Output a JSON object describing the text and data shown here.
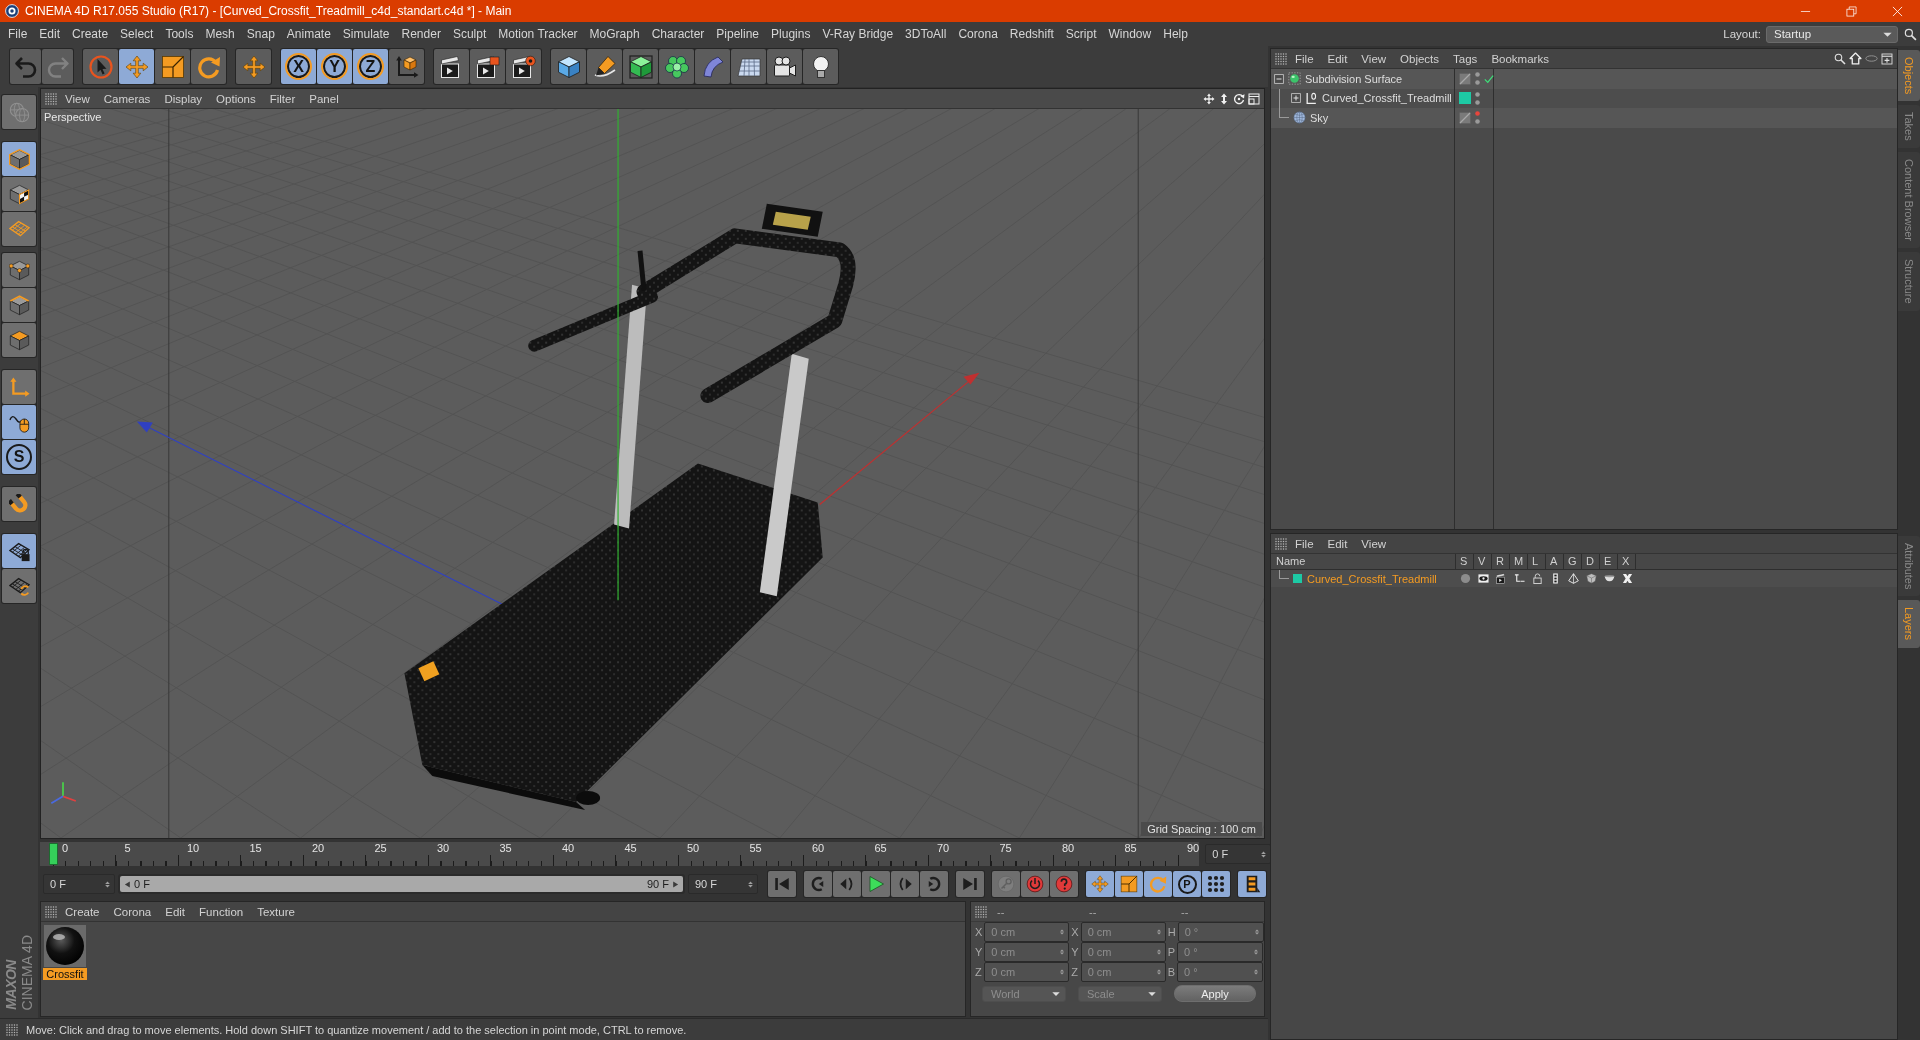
{
  "window": {
    "title": "CINEMA 4D R17.055 Studio (R17) - [Curved_Crossfit_Treadmill_c4d_standart.c4d *] - Main"
  },
  "menu_bar": [
    "File",
    "Edit",
    "Create",
    "Select",
    "Tools",
    "Mesh",
    "Snap",
    "Animate",
    "Simulate",
    "Render",
    "Sculpt",
    "Motion Tracker",
    "MoGraph",
    "Character",
    "Pipeline",
    "Plugins",
    "V-Ray Bridge",
    "3DToAll",
    "Corona",
    "Redshift",
    "Script",
    "Window",
    "Help"
  ],
  "layout": {
    "label": "Layout:",
    "value": "Startup"
  },
  "toolbar": [
    {
      "items": [
        {
          "kind": "undo",
          "selected": false,
          "disabled": false
        },
        {
          "kind": "redo",
          "selected": false,
          "disabled": true
        }
      ]
    },
    {
      "items": [
        {
          "kind": "select",
          "selected": false
        },
        {
          "kind": "move",
          "selected": true
        },
        {
          "kind": "scale",
          "selected": false
        },
        {
          "kind": "rotate",
          "selected": false
        }
      ]
    },
    {
      "items": [
        {
          "kind": "last-tool",
          "selected": false
        }
      ]
    },
    {
      "items": [
        {
          "kind": "axis",
          "label": "X",
          "selected": true
        },
        {
          "kind": "axis",
          "label": "Y",
          "selected": true
        },
        {
          "kind": "axis",
          "label": "Z",
          "selected": true
        },
        {
          "kind": "coordinate-system",
          "selected": false
        }
      ]
    },
    {
      "items": [
        {
          "kind": "render-view",
          "selected": false
        },
        {
          "kind": "render-picture",
          "selected": false
        },
        {
          "kind": "render-settings",
          "selected": false
        }
      ]
    },
    {
      "items": [
        {
          "kind": "cube",
          "selected": false
        },
        {
          "kind": "pen",
          "selected": false
        },
        {
          "kind": "subdivision",
          "selected": false
        },
        {
          "kind": "cloner",
          "selected": false
        },
        {
          "kind": "deformer",
          "selected": false
        },
        {
          "kind": "floor",
          "selected": false
        },
        {
          "kind": "camera",
          "selected": false
        },
        {
          "kind": "light",
          "selected": false
        }
      ]
    }
  ],
  "mode_tools": [
    {
      "items": [
        {
          "kind": "make-editable",
          "selected": false,
          "disabled": true
        }
      ]
    },
    {
      "items": [
        {
          "kind": "model",
          "selected": true
        },
        {
          "kind": "texture",
          "selected": false
        },
        {
          "kind": "workplane",
          "selected": false
        }
      ]
    },
    {
      "items": [
        {
          "kind": "points",
          "selected": false
        },
        {
          "kind": "edges",
          "selected": false
        },
        {
          "kind": "polygons",
          "selected": false
        }
      ]
    },
    {
      "items": [
        {
          "kind": "axis-mode",
          "selected": false
        },
        {
          "kind": "tweak",
          "selected": true
        },
        {
          "kind": "solo",
          "label": "S",
          "selected": true
        }
      ]
    },
    {
      "items": [
        {
          "kind": "snap",
          "selected": false
        }
      ]
    },
    {
      "items": [
        {
          "kind": "workplane-lock",
          "selected": true
        },
        {
          "kind": "workplane-rotate",
          "selected": false
        }
      ]
    }
  ],
  "logo": {
    "brand": "MAXON",
    "product": "CINEMA 4D"
  },
  "viewport": {
    "menu": [
      "View",
      "Cameras",
      "Display",
      "Options",
      "Filter",
      "Panel"
    ],
    "camera": "Perspective",
    "grid_spacing": "Grid Spacing : 100 cm"
  },
  "timeline": {
    "frames": [
      "0",
      "5",
      "10",
      "15",
      "20",
      "25",
      "30",
      "35",
      "40",
      "45",
      "50",
      "55",
      "60",
      "65",
      "70",
      "75",
      "80",
      "85",
      "90"
    ],
    "playhead": {
      "level": 0
    },
    "current_frame": "0 F"
  },
  "transport": {
    "start": "0 F",
    "range": {
      "start": "0 F",
      "end": "90 F",
      "level": 1
    },
    "end": "90 F",
    "groups": [
      {
        "items": [
          {
            "kind": "go-start",
            "selected": false
          }
        ]
      },
      {
        "items": [
          {
            "kind": "previous-key",
            "selected": false
          },
          {
            "kind": "step-back",
            "selected": false
          },
          {
            "kind": "play",
            "selected": false
          },
          {
            "kind": "step-forward",
            "selected": false
          },
          {
            "kind": "next-key",
            "selected": false
          }
        ]
      },
      {
        "items": [
          {
            "kind": "go-end",
            "selected": false
          }
        ]
      },
      {
        "items": [
          {
            "kind": "record-key",
            "selected": false,
            "disabled": true
          },
          {
            "kind": "record",
            "selected": false,
            "disabled": false
          },
          {
            "kind": "auto-key",
            "selected": false,
            "disabled": false
          }
        ]
      },
      {
        "items": [
          {
            "kind": "key-position",
            "selected": true
          },
          {
            "kind": "key-scale",
            "selected": true
          },
          {
            "kind": "key-rotation",
            "selected": true
          },
          {
            "kind": "key-parameter",
            "label": "P",
            "selected": true
          },
          {
            "kind": "key-point-level",
            "selected": true
          }
        ]
      },
      {
        "items": [
          {
            "kind": "timeline",
            "selected": true
          }
        ]
      }
    ]
  },
  "material_manager": {
    "menu": [
      "Create",
      "Corona",
      "Edit",
      "Function",
      "Texture"
    ],
    "materials": [
      {
        "name": "Crossfit",
        "selected": true
      }
    ]
  },
  "coordinates": {
    "headers": [
      "--",
      "--",
      "--"
    ],
    "rows": [
      {
        "position_axis": "X",
        "position": "0 cm",
        "size_axis": "X",
        "size": "0 cm",
        "rotation_axis": "H",
        "rotation": "0 °"
      },
      {
        "position_axis": "Y",
        "position": "0 cm",
        "size_axis": "Y",
        "size": "0 cm",
        "rotation_axis": "P",
        "rotation": "0 °"
      },
      {
        "position_axis": "Z",
        "position": "0 cm",
        "size_axis": "Z",
        "size": "0 cm",
        "rotation_axis": "B",
        "rotation": "0 °"
      }
    ],
    "position_mode": "World",
    "size_mode": "Scale",
    "apply": "Apply"
  },
  "status_bar": {
    "text": "Move: Click and drag to move elements. Hold down SHIFT to quantize movement / add to the selection in point mode, CTRL to remove."
  },
  "object_manager": {
    "menu": [
      "File",
      "Edit",
      "View",
      "Objects",
      "Tags",
      "Bookmarks"
    ],
    "objects": [
      {
        "name": "Subdivision Surface",
        "kind": "subdivision",
        "expanded": true,
        "enabled": true,
        "editor_hidden": false,
        "children": [
          {
            "name": "Curved_Crossfit_Treadmill",
            "kind": "null",
            "expanded": false,
            "editor_hidden": false,
            "layer": {
              "color": "#1dc9a4"
            }
          }
        ]
      },
      {
        "name": "Sky",
        "kind": "sky",
        "editor_hidden": true
      }
    ]
  },
  "layer_manager": {
    "menu": [
      "File",
      "Edit",
      "View"
    ],
    "columns": [
      "Name",
      "S",
      "V",
      "R",
      "M",
      "L",
      "A",
      "G",
      "D",
      "E",
      "X"
    ],
    "layers": [
      {
        "name": "Curved_Crossfit_Treadmill",
        "color": "#1dc9a4",
        "selected": true
      }
    ]
  },
  "side_tabs": {
    "upper": [
      {
        "label": "Objects",
        "selected": true
      },
      {
        "label": "Takes",
        "selected": false
      },
      {
        "label": "Content Browser",
        "selected": false
      },
      {
        "label": "Structure",
        "selected": false
      }
    ],
    "lower": [
      {
        "label": "Attributes",
        "selected": false
      },
      {
        "label": "Layers",
        "selected": true
      }
    ]
  }
}
